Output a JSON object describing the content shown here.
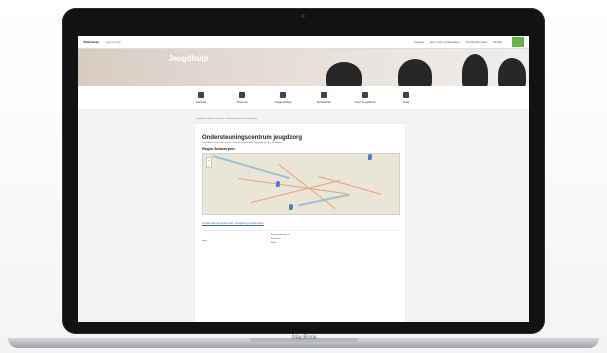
{
  "site": {
    "logo": "Vlaanderen",
    "section": "Agentschap",
    "top_links": [
      "Contact",
      "Hier vind u publicaties",
      "Contactformulier"
    ],
    "user_label": "Profiel"
  },
  "banner": {
    "title": "Jeugdhulp"
  },
  "nav": {
    "items": [
      {
        "label": "Aanbod",
        "icon": "briefcase-icon"
      },
      {
        "label": "Thema's",
        "icon": "globe-icon"
      },
      {
        "label": "Organisaties",
        "icon": "building-icon"
      },
      {
        "label": "Netwerken",
        "icon": "network-icon"
      },
      {
        "label": "Over Jeugdhulp",
        "icon": "info-icon"
      },
      {
        "label": "Antw",
        "icon": "search-icon"
      }
    ]
  },
  "breadcrumb": {
    "text": "Jeugdhulp > Aanbod > Netwerk > Ondersteuningscentrum jeugdzorg"
  },
  "article": {
    "title": "Ondersteuningscentrum jeugdzorg",
    "intro": "De ondersteuningscentra van het Ondersteuningscentrum Jeugdzorg (OCJ) in Vlaanderen.",
    "region": "Regio Antwerpen",
    "map_link": "Ondersteuningscentrum Jeugdzorg Antwerpen",
    "address_label": "Adres",
    "address_lines": [
      "Boomsesteenweg 92",
      "Antwerpen",
      "België"
    ]
  },
  "device": {
    "brand": "MacBook"
  }
}
